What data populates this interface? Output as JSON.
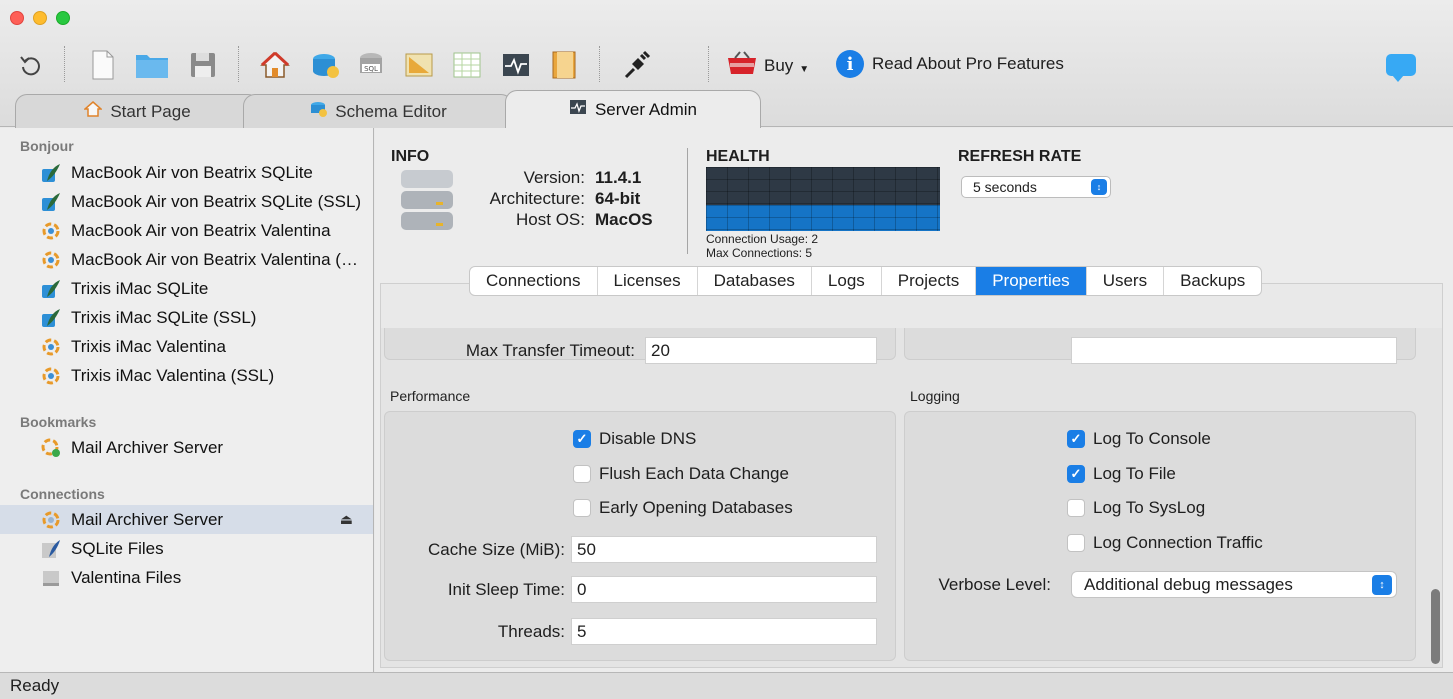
{
  "toolbar": {
    "buy_label": "Buy",
    "pro_label": "Read About Pro Features",
    "icons": [
      "refresh-icon",
      "new-file-icon",
      "open-folder-icon",
      "save-icon",
      "home-icon",
      "schema-icon",
      "sql-icon",
      "ruler-icon",
      "table-icon",
      "monitor-icon",
      "book-icon",
      "plug-icon",
      "basket-icon",
      "info-icon",
      "chat-icon"
    ]
  },
  "tabs": [
    {
      "label": "Start Page",
      "icon": "house-icon"
    },
    {
      "label": "Schema Editor",
      "icon": "schema-icon"
    },
    {
      "label": "Server Admin",
      "icon": "monitor-icon",
      "active": true
    }
  ],
  "sidebar": {
    "bonjour_title": "Bonjour",
    "bonjour": [
      "MacBook Air von Beatrix SQLite",
      "MacBook Air von Beatrix SQLite (SSL)",
      "MacBook Air von Beatrix Valentina",
      "MacBook Air von Beatrix Valentina (SSL)",
      "Trixis iMac SQLite",
      "Trixis iMac SQLite (SSL)",
      "Trixis iMac Valentina",
      "Trixis iMac Valentina (SSL)"
    ],
    "bookmarks_title": "Bookmarks",
    "bookmarks": [
      "Mail Archiver Server"
    ],
    "connections_title": "Connections",
    "connections": [
      "Mail Archiver Server",
      "SQLite Files",
      "Valentina Files"
    ]
  },
  "info": {
    "title": "INFO",
    "version_label": "Version:",
    "version": "11.4.1",
    "arch_label": "Architecture:",
    "arch": "64-bit",
    "os_label": "Host OS:",
    "os": "MacOS"
  },
  "health": {
    "title": "HEALTH",
    "usage_text": "Connection Usage: 2",
    "max_text": "Max Connections: 5",
    "usage": 2,
    "max": 5
  },
  "refresh": {
    "title": "REFRESH RATE",
    "value": "5 seconds"
  },
  "segments": [
    "Connections",
    "Licenses",
    "Databases",
    "Logs",
    "Projects",
    "Properties",
    "Users",
    "Backups"
  ],
  "active_segment": "Properties",
  "properties": {
    "cut_label": "Max Transfer Timeout:",
    "cut_value": "20",
    "performance": {
      "title": "Performance",
      "disable_dns": "Disable DNS",
      "flush": "Flush Each Data Change",
      "early": "Early Opening Databases",
      "cache_label": "Cache Size (MiB):",
      "cache_value": "50",
      "sleep_label": "Init Sleep Time:",
      "sleep_value": "0",
      "threads_label": "Threads:",
      "threads_value": "5"
    },
    "logging": {
      "title": "Logging",
      "console": "Log To Console",
      "file": "Log To File",
      "syslog": "Log To SysLog",
      "traffic": "Log Connection Traffic",
      "verbose_label": "Verbose Level:",
      "verbose_value": "Additional debug messages"
    }
  },
  "status": "Ready",
  "colors": {
    "accent": "#1a7ee6",
    "health_fill": "#1574c6",
    "health_bg": "#2e3945"
  }
}
